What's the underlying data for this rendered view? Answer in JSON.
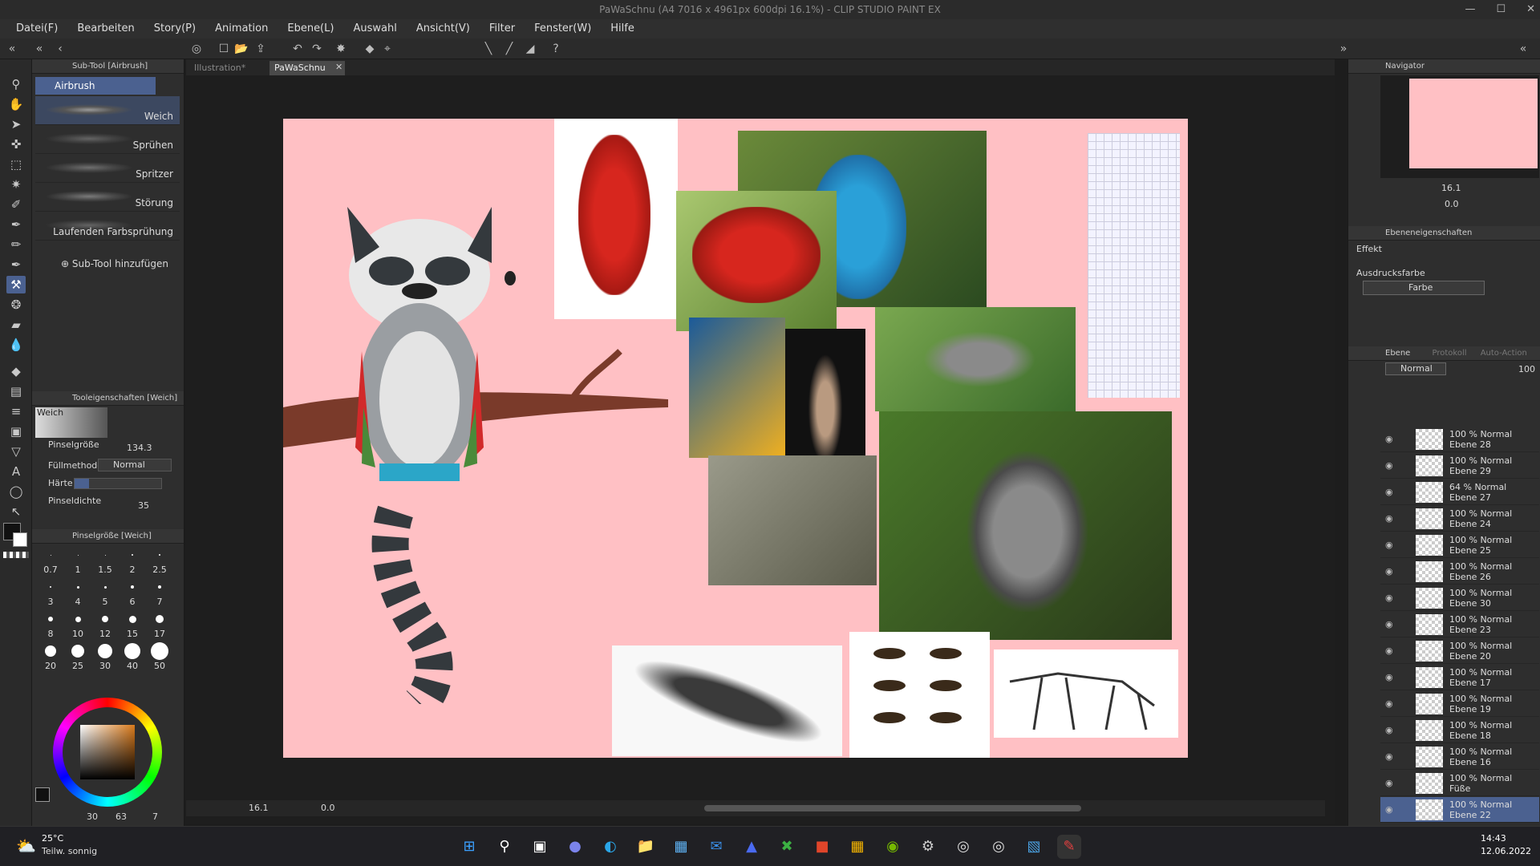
{
  "window": {
    "title": "PaWaSchnu (A4 7016 x 4961px 600dpi 16.1%) - CLIP STUDIO PAINT EX"
  },
  "menu": [
    "Datei(F)",
    "Bearbeiten",
    "Story(P)",
    "Animation",
    "Ebene(L)",
    "Auswahl",
    "Ansicht(V)",
    "Filter",
    "Fenster(W)",
    "Hilfe"
  ],
  "subtool": {
    "header": "Sub-Tool [Airbrush]",
    "group": "Airbrush",
    "brushes": [
      "Weich",
      "Sprühen",
      "Spritzer",
      "Störung",
      "Laufenden Farbsprühung"
    ],
    "add_label": "Sub-Tool hinzufügen"
  },
  "toolprops": {
    "header": "Tooleigenschaften [Weich]",
    "preview_label": "Weich",
    "brush_size_label": "Pinselgröße",
    "brush_size_value": "134.3",
    "fill_label": "Füllmethode",
    "fill_value": "Normal",
    "hardness_label": "Härte",
    "density_label": "Pinseldichte",
    "density_value": "35"
  },
  "brushsize": {
    "header": "Pinselgröße [Weich]",
    "sizes": [
      "0.7",
      "1",
      "1.5",
      "2",
      "2.5",
      "3",
      "4",
      "5",
      "6",
      "7",
      "8",
      "10",
      "12",
      "15",
      "17",
      "20",
      "25",
      "30",
      "40",
      "50"
    ]
  },
  "color": {
    "r_label": "30",
    "g_label": "63",
    "b_label": "7"
  },
  "tabs": [
    {
      "label": "Illustration*"
    },
    {
      "label": "PaWaSchnu"
    }
  ],
  "status": {
    "zoom": "16.1",
    "rotation": "0.0"
  },
  "navigator": {
    "title": "Navigator",
    "zoom": "16.1",
    "angle": "0.0"
  },
  "layerprops": {
    "title": "Ebeneneigenschaften",
    "effect_label": "Effekt",
    "express_label": "Ausdrucksfarbe",
    "express_value": "Farbe"
  },
  "layers": {
    "tab_layer": "Ebene",
    "tab_history": "Protokoll",
    "tab_auto": "Auto-Action",
    "blend": "Normal",
    "opacity": "100",
    "items": [
      {
        "line1": "100 % Normal",
        "line2": "Ebene 28"
      },
      {
        "line1": "100 % Normal",
        "line2": "Ebene 29"
      },
      {
        "line1": "64 % Normal",
        "line2": "Ebene 27"
      },
      {
        "line1": "100 % Normal",
        "line2": "Ebene 24"
      },
      {
        "line1": "100 % Normal",
        "line2": "Ebene 25"
      },
      {
        "line1": "100 % Normal",
        "line2": "Ebene 26"
      },
      {
        "line1": "100 % Normal",
        "line2": "Ebene 30"
      },
      {
        "line1": "100 % Normal",
        "line2": "Ebene 23"
      },
      {
        "line1": "100 % Normal",
        "line2": "Ebene 20"
      },
      {
        "line1": "100 % Normal",
        "line2": "Ebene 17"
      },
      {
        "line1": "100 % Normal",
        "line2": "Ebene 19"
      },
      {
        "line1": "100 % Normal",
        "line2": "Ebene 18"
      },
      {
        "line1": "100 % Normal",
        "line2": "Ebene 16"
      },
      {
        "line1": "100 % Normal",
        "line2": "Füße"
      },
      {
        "line1": "100 % Normal",
        "line2": "Ebene 22"
      }
    ]
  },
  "taskbar": {
    "temp": "25°C",
    "weather": "Teilw. sonnig",
    "time": "14:43",
    "date": "12.06.2022"
  },
  "colors": {
    "accent": "#4b6190",
    "paper": "#ffc0c4",
    "branch": "#7a3a2a"
  }
}
